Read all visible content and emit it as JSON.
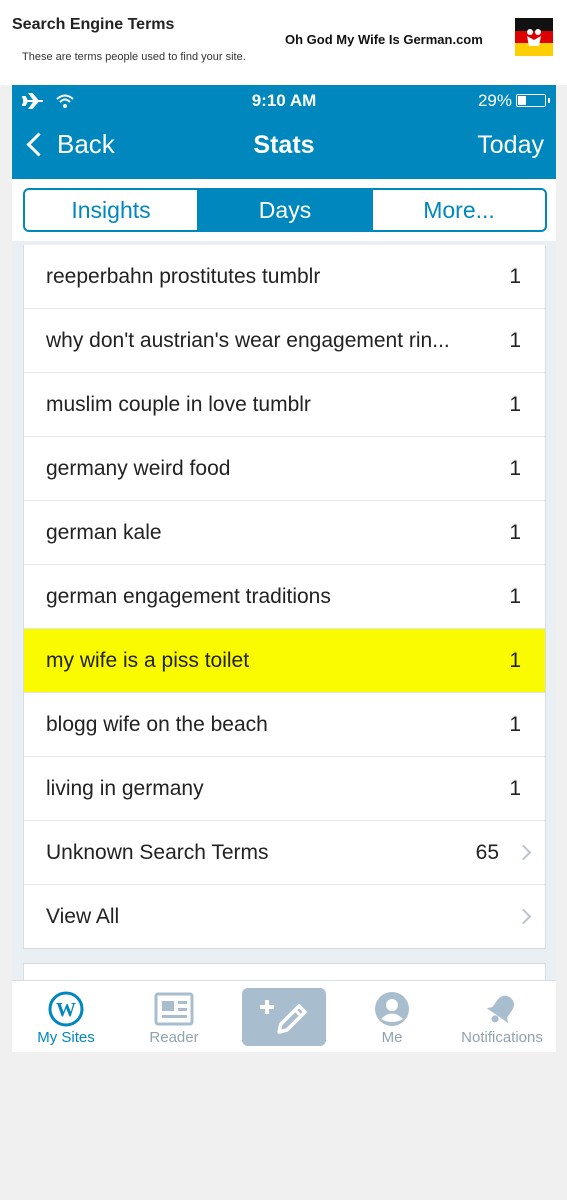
{
  "header": {
    "title": "Search Engine Terms",
    "subtitle": "These are terms people used to find your site.",
    "brand": "Oh God My Wife Is German.com"
  },
  "statusbar": {
    "time": "9:10 AM",
    "battery": "29%",
    "battery_level": 0.29
  },
  "navbar": {
    "back_label": "Back",
    "title": "Stats",
    "right_label": "Today"
  },
  "segments": [
    "Insights",
    "Days",
    "More..."
  ],
  "active_segment": "Days",
  "rows": [
    {
      "term": "reeperbahn prostitutes tumblr",
      "count": "1"
    },
    {
      "term": "why don't austrian's wear engagement rin...",
      "count": "1"
    },
    {
      "term": "muslim couple in love tumblr",
      "count": "1"
    },
    {
      "term": "germany weird food",
      "count": "1"
    },
    {
      "term": "german kale",
      "count": "1"
    },
    {
      "term": "german engagement traditions",
      "count": "1"
    },
    {
      "term": "my wife is a piss toilet",
      "count": "1",
      "highlight": true
    },
    {
      "term": "blogg wife on the beach",
      "count": "1"
    },
    {
      "term": "living in germany",
      "count": "1"
    },
    {
      "term": "Unknown Search Terms",
      "count": "65",
      "chevron": true
    },
    {
      "term": "View All",
      "count": "",
      "chevron": true
    }
  ],
  "tabs": {
    "my_sites": "My Sites",
    "reader": "Reader",
    "me": "Me",
    "notifications": "Notifications"
  },
  "colors": {
    "accent": "#0087be",
    "highlight": "#fbfb00",
    "inactive_tab": "#8fa3b2"
  },
  "icons": {
    "airplane": "airplane-icon",
    "wifi": "wifi-icon",
    "back": "chevron-left-icon",
    "wordpress": "wordpress-icon",
    "reader": "reader-icon",
    "write": "write-post-icon",
    "me": "avatar-icon",
    "notifications": "bell-icon"
  }
}
